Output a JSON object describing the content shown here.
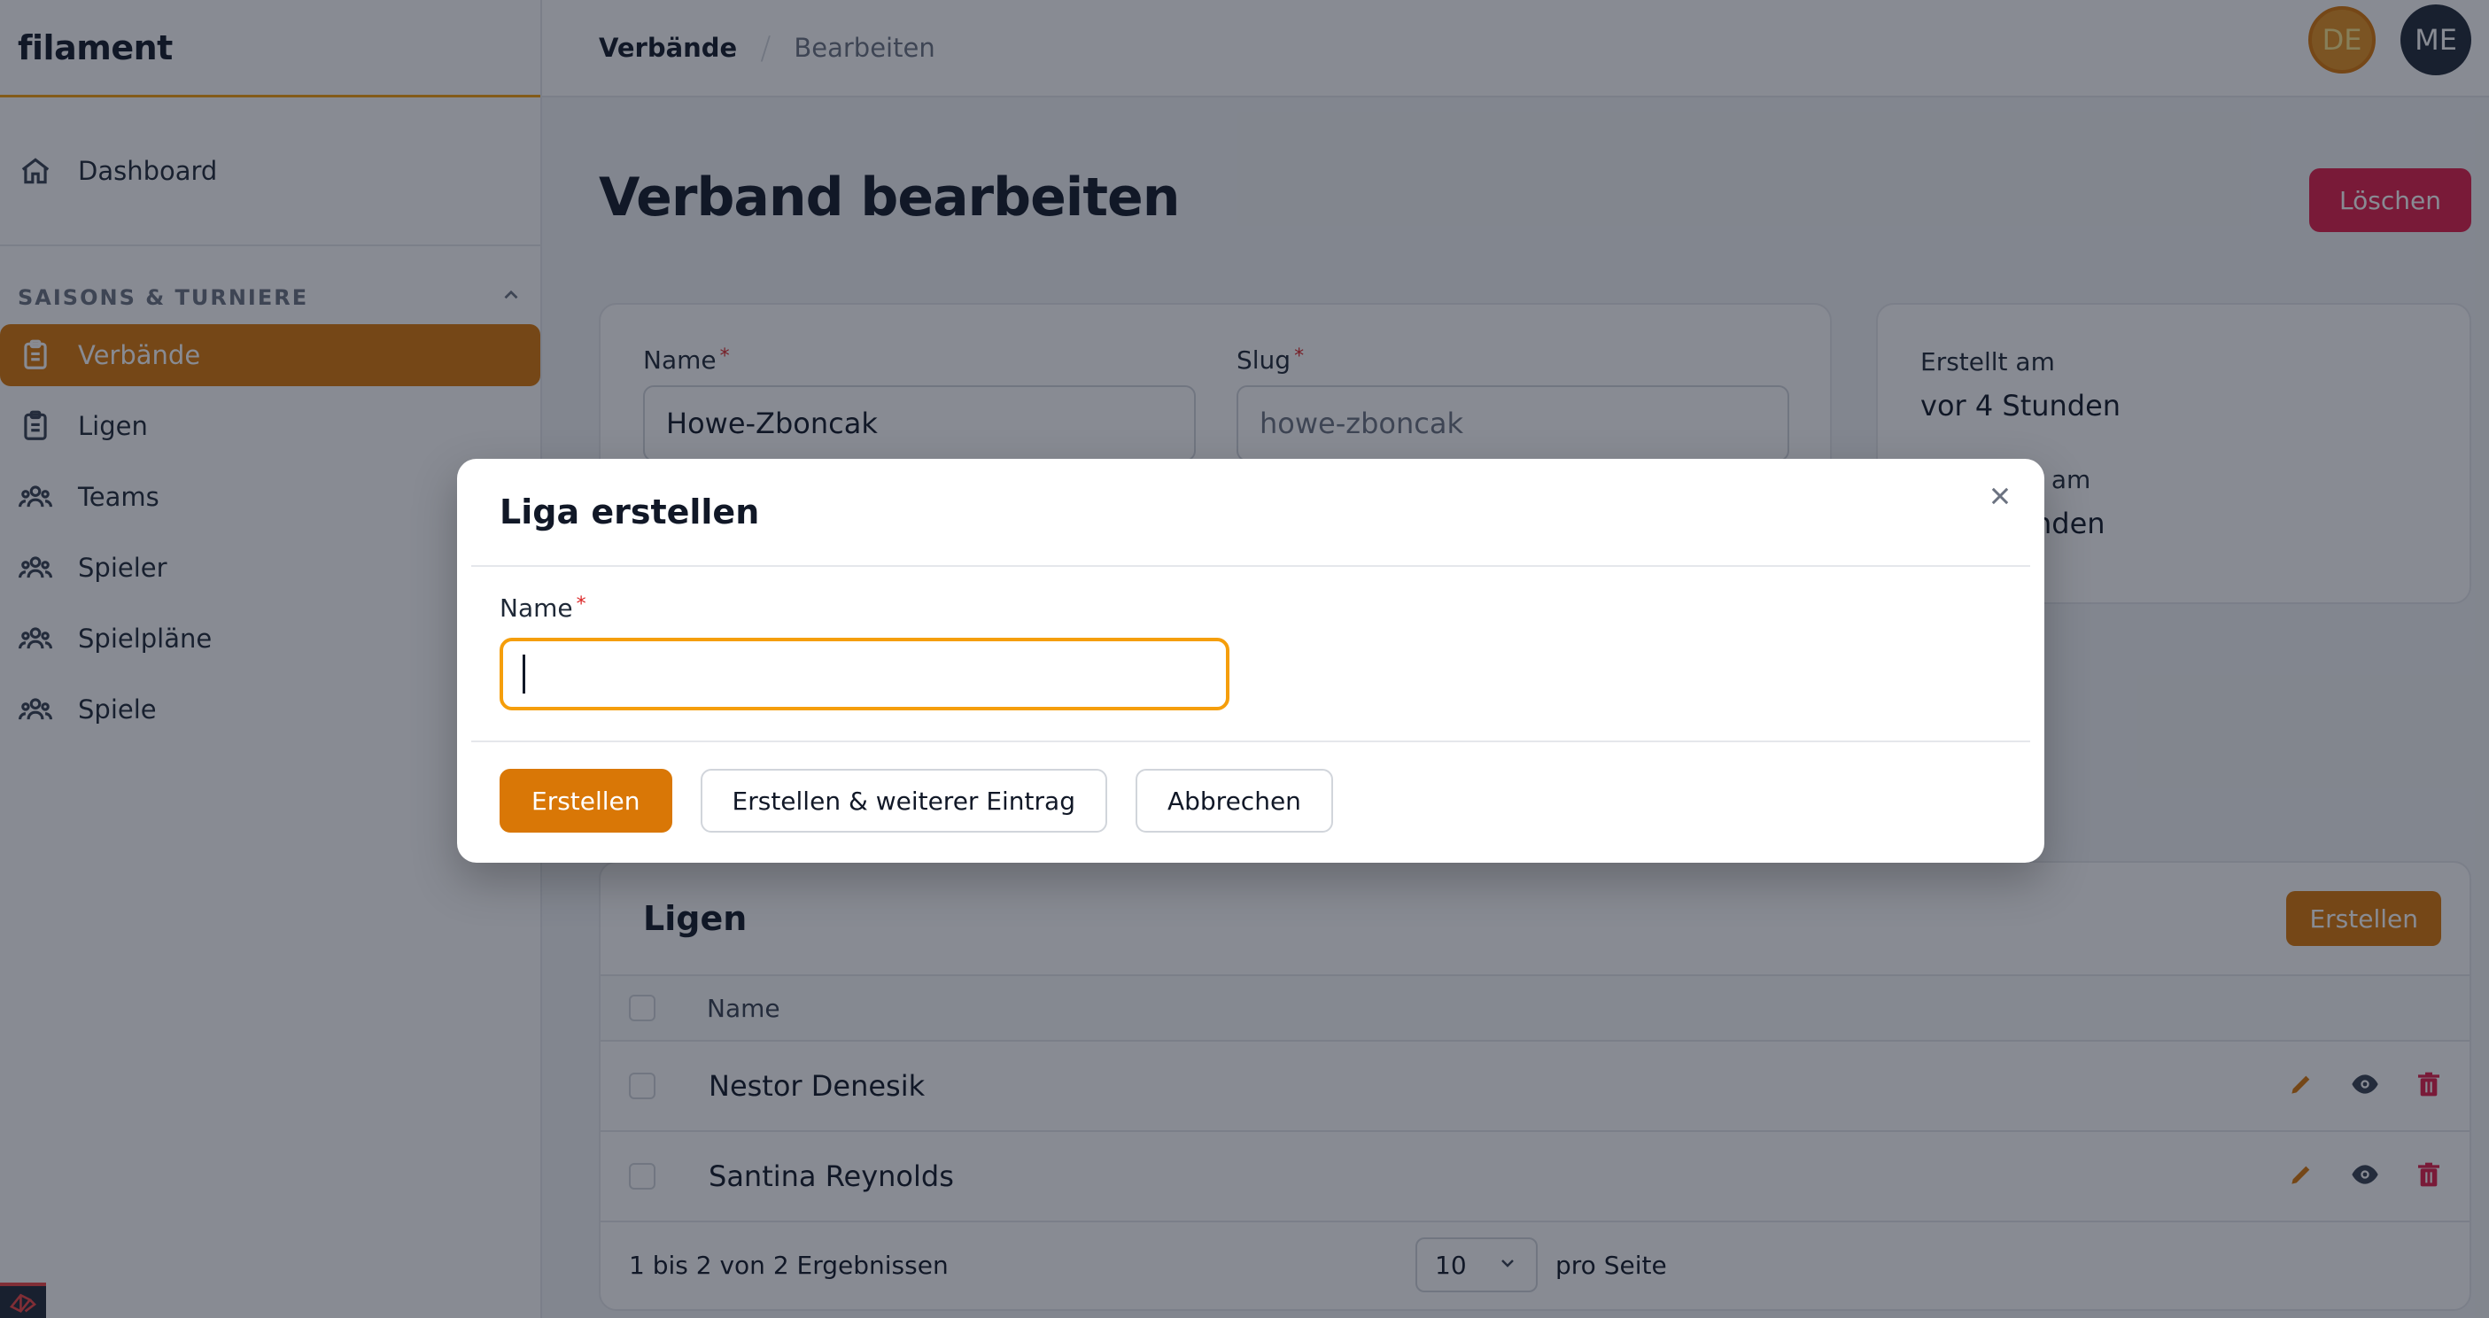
{
  "sidebar": {
    "brand": "filament",
    "dashboard_label": "Dashboard",
    "group_title": "SAISONS & TURNIERE",
    "items": [
      {
        "label": "Verbände",
        "icon": "clipboard-icon"
      },
      {
        "label": "Ligen",
        "icon": "clipboard-icon"
      },
      {
        "label": "Teams",
        "icon": "users-icon"
      },
      {
        "label": "Spieler",
        "icon": "users-icon"
      },
      {
        "label": "Spielpläne",
        "icon": "users-icon"
      },
      {
        "label": "Spiele",
        "icon": "users-icon"
      }
    ]
  },
  "topbar": {
    "breadcrumb_1": "Verbände",
    "breadcrumb_2": "Bearbeiten",
    "avatar_de": "DE",
    "avatar_me": "ME"
  },
  "page": {
    "title": "Verband bearbeiten",
    "delete_label": "Löschen"
  },
  "form": {
    "name_label": "Name",
    "name_value": "Howe-Zboncak",
    "slug_label": "Slug",
    "slug_value": "howe-zboncak",
    "required_mark": "*"
  },
  "meta": {
    "created_label": "Erstellt am",
    "created_value": "vor 4 Stunden",
    "updated_label_partial": "t am",
    "updated_value_partial": "nden"
  },
  "ligen": {
    "title": "Ligen",
    "create_label": "Erstellen",
    "column_name": "Name",
    "rows": [
      {
        "name": "Nestor Denesik"
      },
      {
        "name": "Santina Reynolds"
      }
    ],
    "footer_summary": "1 bis 2 von 2 Ergebnissen",
    "per_page_value": "10",
    "per_page_label": "pro Seite"
  },
  "modal": {
    "title": "Liga erstellen",
    "name_label": "Name",
    "name_value": "",
    "create_label": "Erstellen",
    "create_another_label": "Erstellen & weiterer Eintrag",
    "cancel_label": "Abbrechen"
  },
  "colors": {
    "primary": "#d97706",
    "danger": "#e11d48",
    "input_focus": "#f59e0b"
  }
}
